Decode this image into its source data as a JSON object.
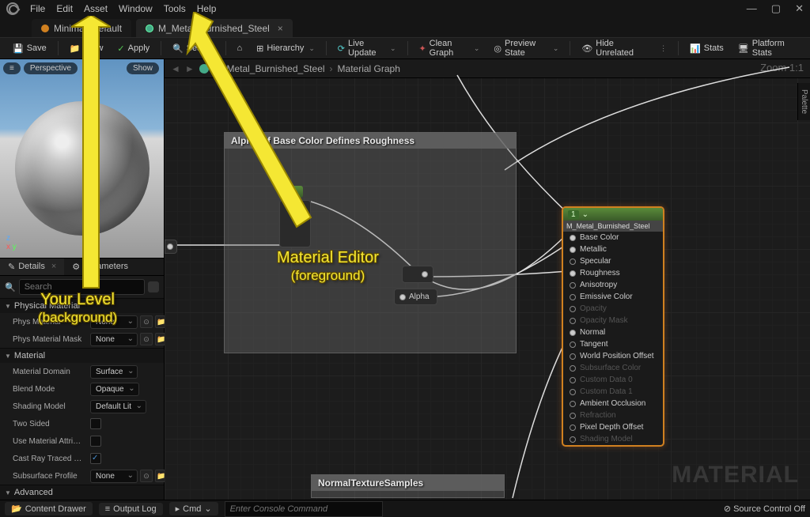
{
  "menubar": [
    "File",
    "Edit",
    "Asset",
    "Window",
    "Tools",
    "Help"
  ],
  "window_controls": {
    "min": "—",
    "max": "▢",
    "close": "✕"
  },
  "tabs": [
    {
      "label": "Minimal_Default",
      "active": false,
      "icon": "level"
    },
    {
      "label": "M_Metal_Burnished_Steel",
      "active": true,
      "icon": "material"
    }
  ],
  "toolbar": {
    "save": "Save",
    "browse": "Brow",
    "apply": "Apply",
    "search": "Search",
    "home": "",
    "hierarchy": "Hierarchy",
    "live_update": "Live Update",
    "clean_graph": "Clean Graph",
    "preview_state": "Preview State",
    "hide_unrelated": "Hide Unrelated",
    "stats": "Stats",
    "platform_stats": "Platform Stats"
  },
  "viewport": {
    "perspective": "Perspective",
    "show": "Show",
    "menu": "≡"
  },
  "detail_tabs": {
    "details": "Details",
    "parameters": "Parameters"
  },
  "search_placeholder": "Search",
  "sections": {
    "phys": {
      "title": "Physical Material",
      "rows": [
        {
          "label": "Phys Material",
          "val": "None"
        },
        {
          "label": "Phys Material Mask",
          "val": "None"
        }
      ]
    },
    "material": {
      "title": "Material",
      "rows": [
        {
          "label": "Material Domain",
          "val": "Surface",
          "type": "dd"
        },
        {
          "label": "Blend Mode",
          "val": "Opaque",
          "type": "dd"
        },
        {
          "label": "Shading Model",
          "val": "Default Lit",
          "type": "dd"
        },
        {
          "label": "Two Sided",
          "type": "cb",
          "checked": false
        },
        {
          "label": "Use Material Attrib…",
          "type": "cb",
          "checked": false
        },
        {
          "label": "Cast Ray Traced S…",
          "type": "cb",
          "checked": true
        },
        {
          "label": "Subsurface Profile",
          "val": "None",
          "type": "asset"
        }
      ]
    },
    "advanced": {
      "title": "Advanced"
    }
  },
  "breadcrumb": {
    "root": "M_Metal_Burnished_Steel",
    "leaf": "Material Graph"
  },
  "zoom": "Zoom 1:1",
  "watermark": "MATERIAL",
  "palette": "Palette",
  "comments": {
    "c1": "Alpha Of Base Color Defines Roughness",
    "c2": "NormalTextureSamples"
  },
  "alpha_node": "Alpha",
  "mat_output": {
    "title": "M_Metal_Burnished_Steel",
    "pins": [
      {
        "label": "Base Color",
        "enabled": true,
        "filled": true
      },
      {
        "label": "Metallic",
        "enabled": true,
        "filled": true
      },
      {
        "label": "Specular",
        "enabled": true,
        "filled": false
      },
      {
        "label": "Roughness",
        "enabled": true,
        "filled": true
      },
      {
        "label": "Anisotropy",
        "enabled": true,
        "filled": false
      },
      {
        "label": "Emissive Color",
        "enabled": true,
        "filled": false
      },
      {
        "label": "Opacity",
        "enabled": false
      },
      {
        "label": "Opacity Mask",
        "enabled": false
      },
      {
        "label": "Normal",
        "enabled": true,
        "filled": true
      },
      {
        "label": "Tangent",
        "enabled": true,
        "filled": false
      },
      {
        "label": "World Position Offset",
        "enabled": true,
        "filled": false
      },
      {
        "label": "Subsurface Color",
        "enabled": false
      },
      {
        "label": "Custom Data 0",
        "enabled": false
      },
      {
        "label": "Custom Data 1",
        "enabled": false
      },
      {
        "label": "Ambient Occlusion",
        "enabled": true,
        "filled": false
      },
      {
        "label": "Refraction",
        "enabled": false
      },
      {
        "label": "Pixel Depth Offset",
        "enabled": true,
        "filled": false
      },
      {
        "label": "Shading Model",
        "enabled": false
      }
    ]
  },
  "statusbar": {
    "content_drawer": "Content Drawer",
    "output_log": "Output Log",
    "cmd": "Cmd",
    "cmd_placeholder": "Enter Console Command",
    "source_control": "Source Control Off"
  },
  "annotations": {
    "a1_line1": "Material Editor",
    "a1_line2": "(foreground)",
    "a2_line1": "Your Level",
    "a2_line2": "(background)"
  }
}
